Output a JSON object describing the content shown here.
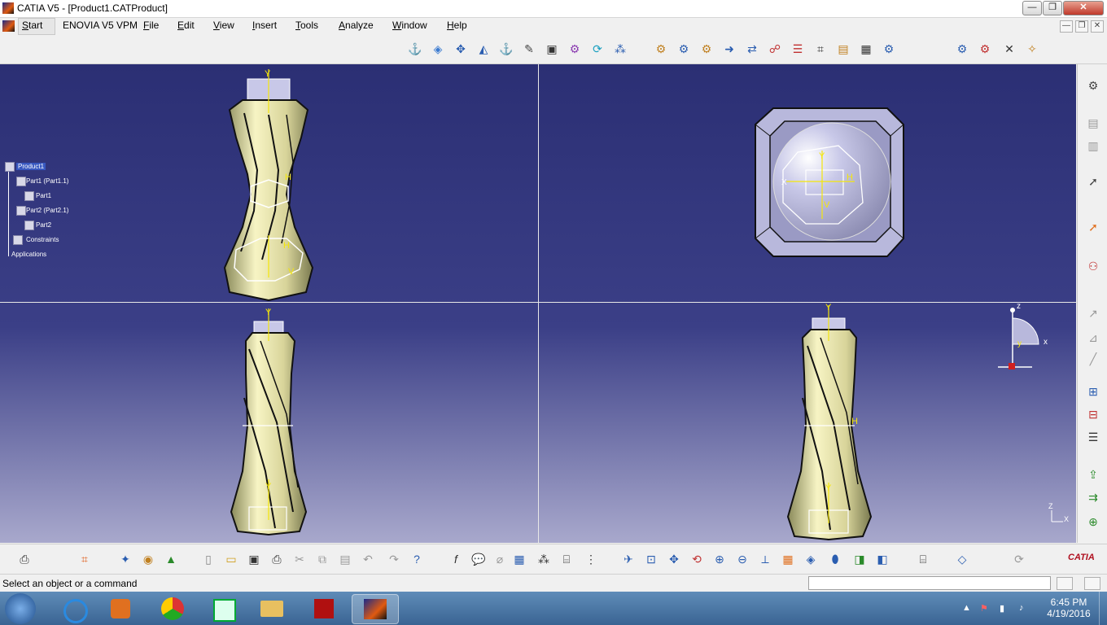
{
  "window": {
    "title": "CATIA V5 - [Product1.CATProduct]",
    "buttons": [
      "—",
      "❐",
      "✕"
    ]
  },
  "menubar": {
    "items": [
      {
        "label": "Start",
        "u": "S"
      },
      {
        "label": "ENOVIA V5 VPM"
      },
      {
        "label": "File",
        "u": "F"
      },
      {
        "label": "Edit",
        "u": "E"
      },
      {
        "label": "View",
        "u": "V"
      },
      {
        "label": "Insert",
        "u": "I"
      },
      {
        "label": "Tools",
        "u": "T"
      },
      {
        "label": "Analyze",
        "u": "A"
      },
      {
        "label": "Window",
        "u": "W"
      },
      {
        "label": "Help",
        "u": "H"
      }
    ],
    "mdi_buttons": [
      "—",
      "❐",
      "✕"
    ]
  },
  "tree": {
    "root": "Product1",
    "items": [
      {
        "label": "Part1 (Part1.1)",
        "level": 1
      },
      {
        "label": "Part1",
        "level": 2
      },
      {
        "label": "Part2 (Part2.1)",
        "level": 1
      },
      {
        "label": "Part2",
        "level": 2
      },
      {
        "label": "Constraints",
        "level": 1
      },
      {
        "label": "Applications",
        "level": 0
      }
    ]
  },
  "compass": {
    "x": "x",
    "y": "y",
    "z": "z"
  },
  "triad": {
    "z": "Z",
    "x": "X"
  },
  "viewport_marks": {
    "y": "Y",
    "h": "H",
    "v": "V",
    "x": "X"
  },
  "status": {
    "text": "Select an object or a command"
  },
  "catia_logo": "CATIA",
  "taskbar": {
    "time": "6:45 PM",
    "date": "4/19/2016"
  },
  "colors": {
    "viewport_top": "#2b2f74",
    "viewport_bottom": "#a8a8cc",
    "model_fill": "#e9e6b0",
    "construction": "#f4e60a"
  }
}
